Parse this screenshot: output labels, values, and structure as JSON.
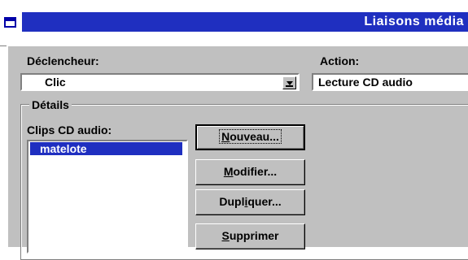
{
  "window": {
    "title": "Liaisons média"
  },
  "form": {
    "trigger_label": "Déclencheur:",
    "trigger_value": "Clic",
    "action_label": "Action:",
    "action_value": "Lecture CD audio",
    "details_label": "Détails",
    "clips_label": "Clips CD audio:",
    "clips": [
      "matelote"
    ]
  },
  "buttons": {
    "new": {
      "accel": "N",
      "rest": "ouveau..."
    },
    "modify": {
      "accel": "M",
      "rest": "odifier..."
    },
    "duplicate": {
      "pre": "Dupl",
      "accel": "i",
      "rest": "quer..."
    },
    "delete": {
      "accel": "S",
      "rest": "upprimer"
    }
  },
  "colors": {
    "title_bar": "#1f2fc0",
    "dialog_face": "#c0c0c0",
    "selection": "#1f2fc0"
  }
}
